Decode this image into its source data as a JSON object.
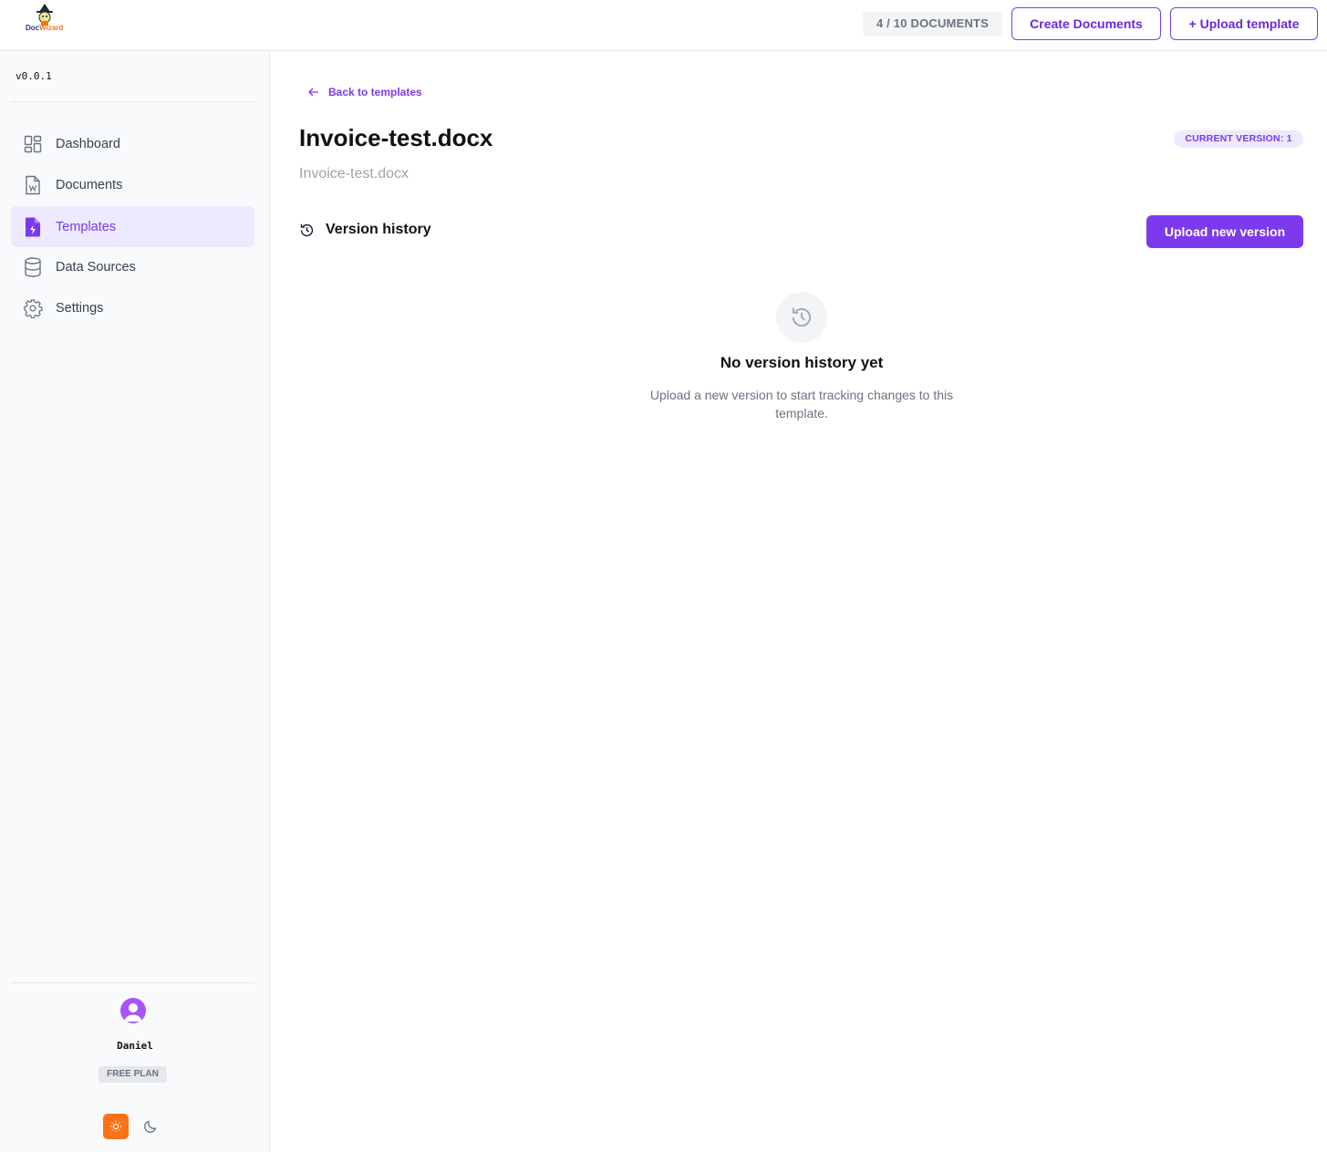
{
  "app": {
    "logo_text_part1": "Doc",
    "logo_text_part2": "Wizard",
    "version": "v0.0.1"
  },
  "header": {
    "doc_count": "4 / 10 DOCUMENTS",
    "create_documents_label": "Create Documents",
    "upload_template_label": "+ Upload template"
  },
  "sidebar": {
    "items": [
      {
        "label": "Dashboard",
        "icon": "dashboard-icon",
        "active": false
      },
      {
        "label": "Documents",
        "icon": "word-file-icon",
        "active": false
      },
      {
        "label": "Templates",
        "icon": "template-file-icon",
        "active": true
      },
      {
        "label": "Data Sources",
        "icon": "database-icon",
        "active": false
      },
      {
        "label": "Settings",
        "icon": "gear-icon",
        "active": false
      }
    ],
    "user": {
      "name": "Daniel",
      "plan": "FREE PLAN"
    },
    "theme": {
      "selected": "light"
    }
  },
  "main": {
    "back_label": "Back to templates",
    "title": "Invoice-test.docx",
    "subtitle": "Invoice-test.docx",
    "current_version_badge": "CURRENT VERSION: 1",
    "version_history_title": "Version history",
    "upload_new_version_label": "Upload new version",
    "empty_state": {
      "title": "No version history yet",
      "description": "Upload a new version to start tracking changes to this template."
    }
  },
  "colors": {
    "accent": "#7c3aed",
    "accent_soft": "#ede9fe",
    "theme_light_active": "#f97316"
  }
}
